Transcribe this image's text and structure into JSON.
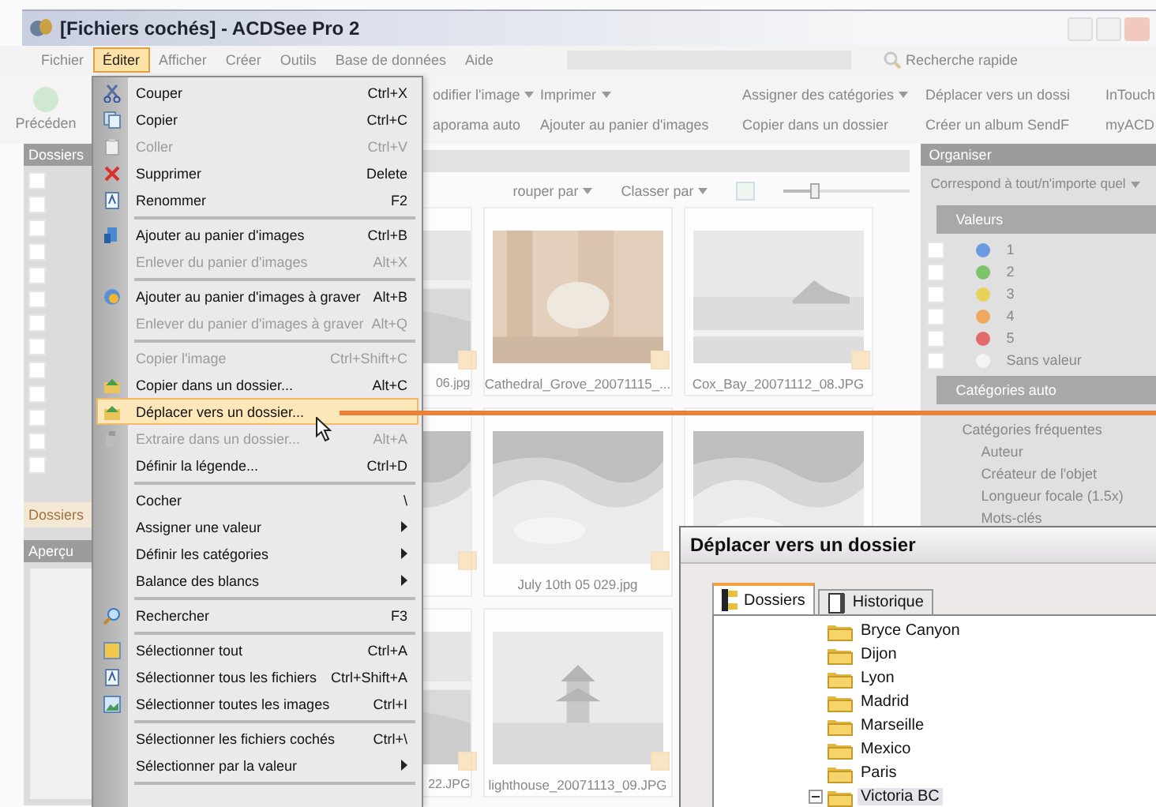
{
  "window": {
    "title": "[Fichiers cochés] - ACDSee Pro 2"
  },
  "menubar": [
    {
      "label": "Fichier",
      "selected": false
    },
    {
      "label": "Éditer",
      "selected": true
    },
    {
      "label": "Afficher",
      "selected": false
    },
    {
      "label": "Créer",
      "selected": false
    },
    {
      "label": "Outils",
      "selected": false
    },
    {
      "label": "Base de données",
      "selected": false
    },
    {
      "label": "Aide",
      "selected": false
    }
  ],
  "quick_search": {
    "label": "Recherche rapide"
  },
  "toolbar": {
    "back": "Précéden",
    "rows": [
      [
        {
          "label": "odifier l'image",
          "dropdown": true
        },
        {
          "label": "Imprimer",
          "dropdown": true
        },
        {
          "label": "Assigner des catégories",
          "dropdown": true
        },
        {
          "label": "Déplacer vers un dossi",
          "dropdown": false
        },
        {
          "label": "InTouch",
          "dropdown": false
        }
      ],
      [
        {
          "label": "aporama auto",
          "dropdown": false
        },
        {
          "label": "Ajouter au panier d'images",
          "dropdown": false
        },
        {
          "label": "Copier dans un dossier",
          "dropdown": false
        },
        {
          "label": "Créer un album SendF",
          "dropdown": false
        },
        {
          "label": "myACD",
          "dropdown": false
        }
      ]
    ]
  },
  "folders_panel": {
    "title": "Dossiers",
    "checkboxes": [
      {
        "checked": false
      },
      {
        "checked": false
      },
      {
        "checked": false
      },
      {
        "checked": false
      },
      {
        "checked": false
      },
      {
        "checked": false
      },
      {
        "checked": false
      },
      {
        "checked": false
      },
      {
        "checked": false
      },
      {
        "checked": false
      },
      {
        "checked": false
      },
      {
        "checked": false
      },
      {
        "checked": false
      }
    ],
    "tab": "Dossiers",
    "preview_title": "Aperçu"
  },
  "browser": {
    "group_by": "rouper par",
    "sort_by": "Classer par",
    "zoom": {
      "level": 0.25
    },
    "thumbnails": [
      {
        "kind": "picture",
        "caption": "06.jpg",
        "checked": true
      },
      {
        "kind": "picture",
        "caption": "Cathedral_Grove_20071115_...",
        "checked": true
      },
      {
        "kind": "picture",
        "caption": "Cox_Bay_20071112_08.JPG",
        "checked": true
      },
      {
        "kind": "picture",
        "checked": true
      },
      {
        "kind": "picture",
        "caption": "July 10th 05 029.jpg",
        "checked": true
      },
      {
        "kind": "picture"
      },
      {
        "kind": "picture",
        "caption": "22.JPG",
        "checked": true
      },
      {
        "kind": "picture",
        "caption": "lighthouse_20071113_09.JPG",
        "checked": true
      }
    ]
  },
  "organizer": {
    "title": "Organiser",
    "match": "Correspond à tout/n'importe quel",
    "values_title": "Valeurs",
    "values": [
      {
        "label": "1",
        "color": "#6b9ae0",
        "checked": false
      },
      {
        "label": "2",
        "color": "#7cc36b",
        "checked": false
      },
      {
        "label": "3",
        "color": "#e8d25a",
        "checked": false
      },
      {
        "label": "4",
        "color": "#f0a860",
        "checked": false
      },
      {
        "label": "5",
        "color": "#e26a6a",
        "checked": false
      },
      {
        "label": "Sans valeur",
        "color": "#f4f4f4",
        "checked": false
      }
    ],
    "auto_title": "Catégories auto",
    "frequent": "Catégories fréquentes",
    "categories": [
      "Auteur",
      "Créateur de l'objet",
      "Longueur focale (1.5x)",
      "Mots-clés"
    ]
  },
  "edit_menu": [
    {
      "kind": "item",
      "label": "Couper",
      "shortcut": "Ctrl+X",
      "disabled": false,
      "selected": false
    },
    {
      "kind": "item",
      "label": "Copier",
      "shortcut": "Ctrl+C",
      "disabled": false,
      "selected": false
    },
    {
      "kind": "item",
      "label": "Coller",
      "shortcut": "Ctrl+V",
      "disabled": true,
      "selected": false
    },
    {
      "kind": "item",
      "label": "Supprimer",
      "shortcut": "Delete",
      "disabled": false,
      "selected": false
    },
    {
      "kind": "item",
      "label": "Renommer",
      "shortcut": "F2",
      "disabled": false,
      "selected": false
    },
    {
      "kind": "separator"
    },
    {
      "kind": "item",
      "label": "Ajouter au panier d'images",
      "shortcut": "Ctrl+B",
      "disabled": false,
      "selected": false
    },
    {
      "kind": "item",
      "label": "Enlever du panier d'images",
      "shortcut": "Alt+X",
      "disabled": true,
      "selected": false
    },
    {
      "kind": "separator"
    },
    {
      "kind": "item",
      "label": "Ajouter au panier d'images à graver",
      "shortcut": "Alt+B",
      "disabled": false,
      "selected": false
    },
    {
      "kind": "item",
      "label": "Enlever du panier d'images à graver",
      "shortcut": "Alt+Q",
      "disabled": true,
      "selected": false
    },
    {
      "kind": "separator"
    },
    {
      "kind": "item",
      "label": "Copier l'image",
      "shortcut": "Ctrl+Shift+C",
      "disabled": true,
      "selected": false
    },
    {
      "kind": "item",
      "label": "Copier dans un dossier...",
      "shortcut": "Alt+C",
      "disabled": false,
      "selected": false
    },
    {
      "kind": "item",
      "label": "Déplacer vers un dossier...",
      "disabled": false,
      "selected": true
    },
    {
      "kind": "item",
      "label": "Extraire dans un dossier...",
      "shortcut": "Alt+A",
      "disabled": true,
      "selected": false
    },
    {
      "kind": "item",
      "label": "Définir la légende...",
      "shortcut": "Ctrl+D",
      "disabled": false,
      "selected": false
    },
    {
      "kind": "separator"
    },
    {
      "kind": "item",
      "label": "Cocher",
      "shortcut": "\\",
      "disabled": false,
      "selected": false
    },
    {
      "kind": "submenu",
      "label": "Assigner une valeur",
      "disabled": false,
      "selected": false
    },
    {
      "kind": "submenu",
      "label": "Définir les catégories",
      "disabled": false,
      "selected": false
    },
    {
      "kind": "submenu",
      "label": "Balance des blancs",
      "disabled": false,
      "selected": false
    },
    {
      "kind": "separator"
    },
    {
      "kind": "item",
      "label": "Rechercher",
      "shortcut": "F3",
      "disabled": false,
      "selected": false
    },
    {
      "kind": "separator"
    },
    {
      "kind": "item",
      "label": "Sélectionner tout",
      "shortcut": "Ctrl+A",
      "disabled": false,
      "selected": false
    },
    {
      "kind": "item",
      "label": "Sélectionner tous les fichiers",
      "shortcut": "Ctrl+Shift+A",
      "disabled": false,
      "selected": false
    },
    {
      "kind": "item",
      "label": "Sélectionner toutes les images",
      "shortcut": "Ctrl+I",
      "disabled": false,
      "selected": false
    },
    {
      "kind": "separator"
    },
    {
      "kind": "item",
      "label": "Sélectionner les fichiers cochés",
      "shortcut": "Ctrl+\\",
      "disabled": false,
      "selected": false
    },
    {
      "kind": "submenu",
      "label": "Sélectionner par la valeur",
      "disabled": false,
      "selected": false
    },
    {
      "kind": "separator"
    }
  ],
  "dialog": {
    "title": "Déplacer vers un dossier",
    "tabs": [
      {
        "label": "Dossiers",
        "selected": true
      },
      {
        "label": "Historique",
        "selected": false
      }
    ],
    "tree": [
      {
        "label": "Bryce Canyon",
        "selected": false
      },
      {
        "label": "Dijon",
        "selected": false
      },
      {
        "label": "Lyon",
        "selected": false
      },
      {
        "label": "Madrid",
        "selected": false
      },
      {
        "label": "Marseille",
        "selected": false
      },
      {
        "label": "Mexico",
        "selected": false
      },
      {
        "label": "Paris",
        "selected": false
      },
      {
        "label": "Victoria BC",
        "selected": true,
        "expanded": true
      }
    ]
  }
}
